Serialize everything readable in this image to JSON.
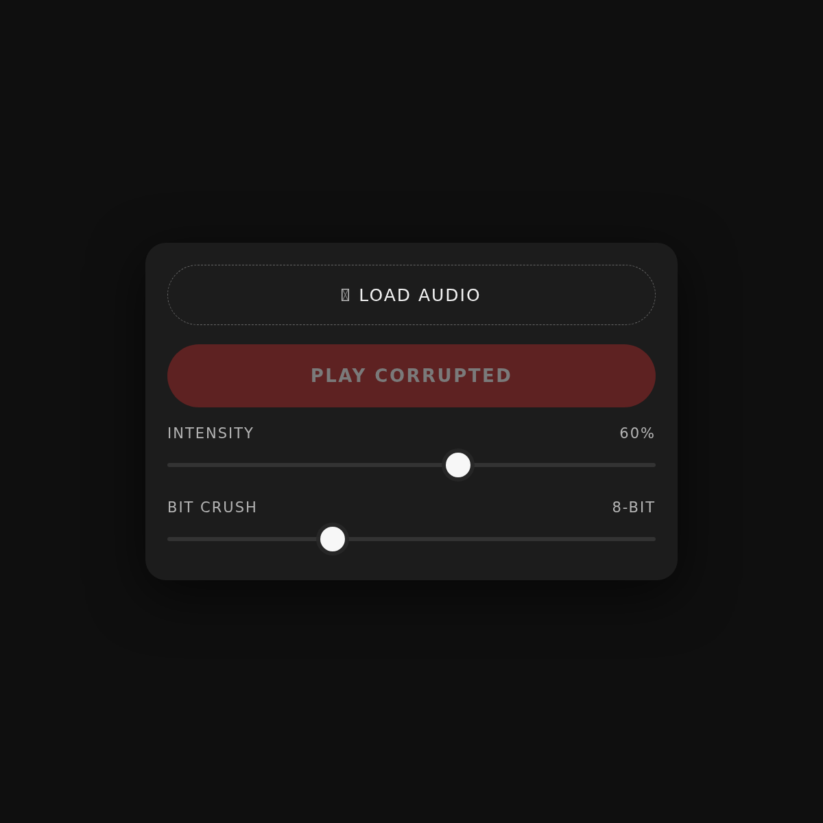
{
  "load_button": {
    "label": "LOAD AUDIO"
  },
  "play_button": {
    "label": "PLAY CORRUPTED",
    "disabled": true
  },
  "sliders": [
    {
      "label": "INTENSITY",
      "reading": "60%",
      "level": 0.6
    },
    {
      "label": "BIT CRUSH",
      "reading": "8-BIT",
      "level": 0.33
    }
  ]
}
